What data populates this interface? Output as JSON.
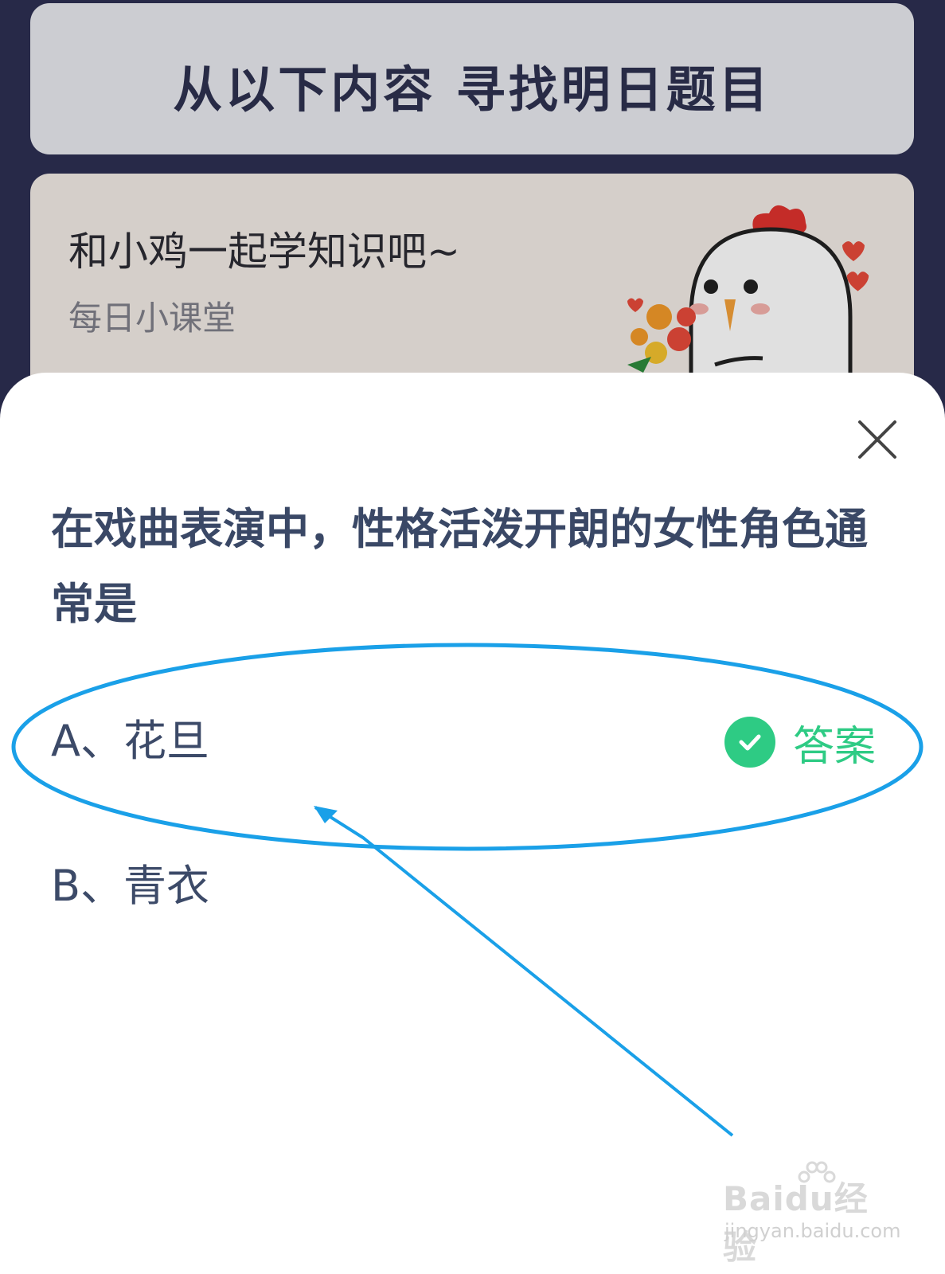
{
  "background": {
    "heading": "从以下内容 寻找明日题目",
    "lesson_card": {
      "title": "和小鸡一起学知识吧~",
      "subtitle": "每日小课堂"
    }
  },
  "quiz": {
    "question": "在戏曲表演中，性格活泼开朗的女性角色通常是",
    "options": [
      {
        "label": "A、花旦",
        "is_answer": true
      },
      {
        "label": "B、青衣",
        "is_answer": false
      }
    ],
    "answer_badge": "答案"
  },
  "watermark": {
    "brand": "Baidu经验",
    "url": "jingyan.baidu.com"
  },
  "colors": {
    "annotation_blue": "#1aa0e8",
    "answer_green": "#2ecb84",
    "question_text": "#3a4866"
  }
}
